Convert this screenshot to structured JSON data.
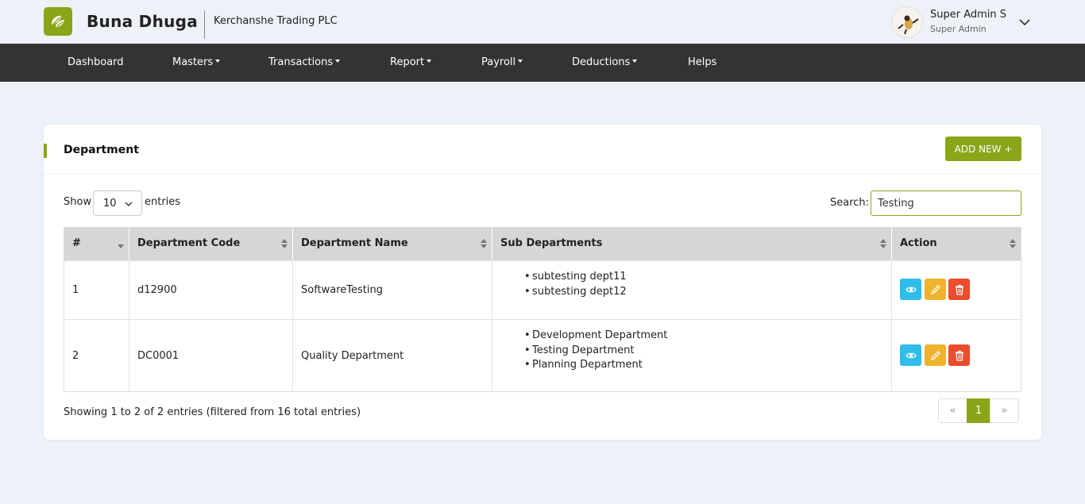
{
  "header": {
    "brand": "Buna Dhuga",
    "company": "Kerchanshe Trading PLC",
    "user_name": "Super Admin S",
    "user_role": "Super Admin"
  },
  "nav": [
    {
      "label": "Dashboard"
    },
    {
      "label": "Masters"
    },
    {
      "label": "Transactions"
    },
    {
      "label": "Report"
    },
    {
      "label": "Payroll"
    },
    {
      "label": "Deductions"
    },
    {
      "label": "Helps"
    }
  ],
  "page": {
    "title": "Department",
    "add_label": "ADD NEW +"
  },
  "controls": {
    "show_label": "Show",
    "page_length": "10",
    "entries_label": "entries",
    "search_label": "Search:",
    "search_value": "Testing"
  },
  "table": {
    "columns": [
      "#",
      "Department Code",
      "Department Name",
      "Sub Departments",
      "Action"
    ],
    "rows": [
      {
        "no": "1",
        "code": "d12900",
        "name": "SoftwareTesting",
        "subs": [
          "subtesting dept11",
          "subtesting dept12"
        ]
      },
      {
        "no": "2",
        "code": "DC0001",
        "name": "Quality Department",
        "subs": [
          "Development Department",
          "Testing Department",
          "Planning Department"
        ]
      }
    ]
  },
  "footer": {
    "info": "Showing 1 to 2 of 2 entries (filtered from 16 total entries)",
    "prev": "«",
    "current_page": "1",
    "next": "»"
  },
  "colors": {
    "accent": "#8aa517",
    "navbar": "#333333",
    "view": "#31bdea",
    "edit": "#f0b32e",
    "delete": "#eb4d2d"
  }
}
